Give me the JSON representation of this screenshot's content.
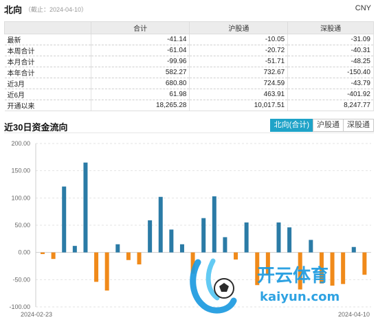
{
  "header": {
    "title": "北向",
    "date_note": "（截止：2024-04-10）",
    "currency": "CNY"
  },
  "table": {
    "columns": [
      "",
      "合计",
      "沪股通",
      "深股通"
    ],
    "rows": [
      {
        "label": "最新",
        "total": "-41.14",
        "sh": "-10.05",
        "sz": "-31.09"
      },
      {
        "label": "本周合计",
        "total": "-61.04",
        "sh": "-20.72",
        "sz": "-40.31"
      },
      {
        "label": "本月合计",
        "total": "-99.96",
        "sh": "-51.71",
        "sz": "-48.25"
      },
      {
        "label": "本年合计",
        "total": "582.27",
        "sh": "732.67",
        "sz": "-150.40"
      },
      {
        "label": "近3月",
        "total": "680.80",
        "sh": "724.59",
        "sz": "-43.79"
      },
      {
        "label": "近6月",
        "total": "61.98",
        "sh": "463.91",
        "sz": "-401.92"
      },
      {
        "label": "开通以来",
        "total": "18,265.28",
        "sh": "10,017.51",
        "sz": "8,247.77"
      }
    ]
  },
  "section_title": "近30日资金流向",
  "tabs": [
    {
      "label": "北向(合计)",
      "active": true
    },
    {
      "label": "沪股通",
      "active": false
    },
    {
      "label": "深股通",
      "active": false
    }
  ],
  "watermark": {
    "brand": "开云体育",
    "url": "kaiyun.com"
  },
  "colors": {
    "positive": "#2b7ba6",
    "negative": "#f08a1a",
    "tab_active": "#1fa3c8"
  },
  "chart_data": {
    "type": "bar",
    "ylim": [
      -100,
      200
    ],
    "yticks": [
      "200.00",
      "150.00",
      "100.00",
      "50.00",
      "0.00",
      "-50.00",
      "-100.00"
    ],
    "ytick_values": [
      200,
      150,
      100,
      50,
      0,
      -50,
      -100
    ],
    "x_start_label": "2024-02-23",
    "x_end_label": "2024-04-10",
    "values": [
      -3,
      -12,
      121,
      12,
      165,
      -54,
      -70,
      15,
      -14,
      -22,
      59,
      102,
      42,
      15,
      -39,
      63,
      103,
      28,
      -13,
      55,
      -60,
      -41,
      55,
      46,
      -68,
      23,
      -57,
      -61,
      -58,
      10,
      -41
    ]
  }
}
